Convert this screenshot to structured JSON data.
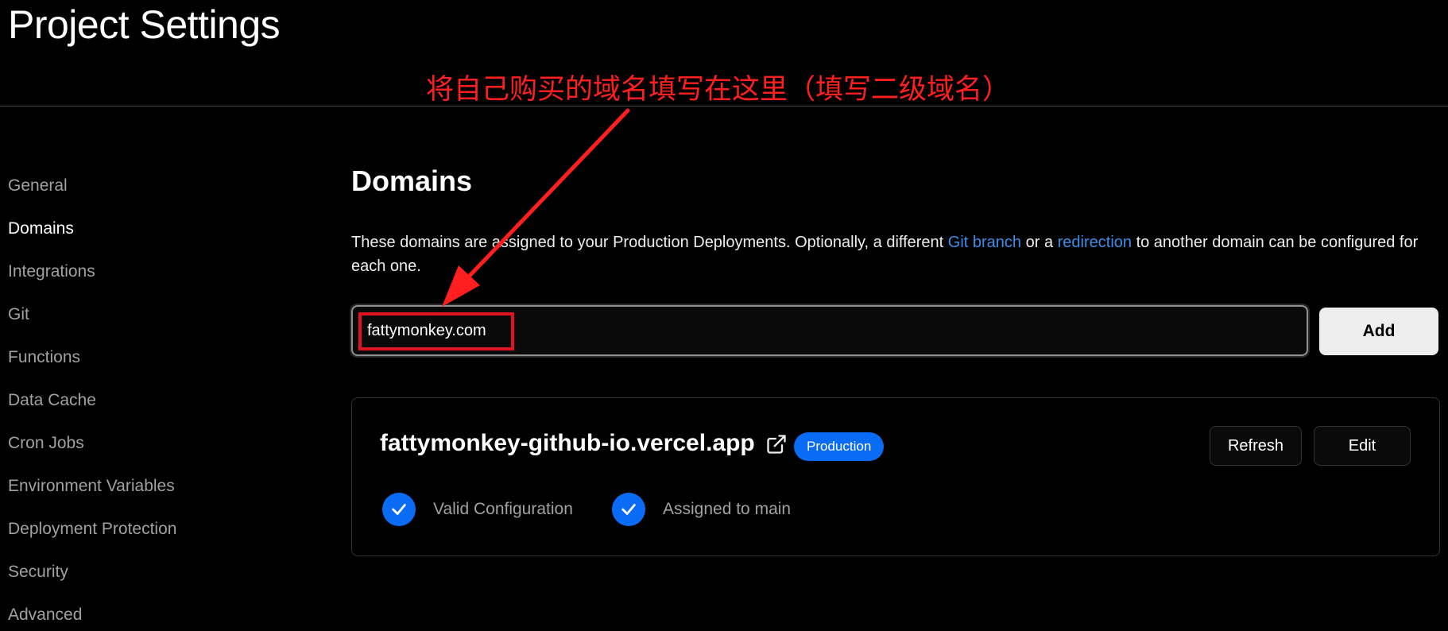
{
  "header": {
    "title": "Project Settings"
  },
  "annotation": {
    "text": "将自己购买的域名填写在这里（填写二级域名）",
    "color": "#ff1f1f"
  },
  "sidebar": {
    "items": [
      {
        "label": "General",
        "active": false
      },
      {
        "label": "Domains",
        "active": true
      },
      {
        "label": "Integrations",
        "active": false
      },
      {
        "label": "Git",
        "active": false
      },
      {
        "label": "Functions",
        "active": false
      },
      {
        "label": "Data Cache",
        "active": false
      },
      {
        "label": "Cron Jobs",
        "active": false
      },
      {
        "label": "Environment Variables",
        "active": false
      },
      {
        "label": "Deployment Protection",
        "active": false
      },
      {
        "label": "Security",
        "active": false
      },
      {
        "label": "Advanced",
        "active": false
      }
    ]
  },
  "domains": {
    "title": "Domains",
    "description": {
      "part1": "These domains are assigned to your Production Deployments. Optionally, a different ",
      "link1": "Git branch",
      "part2": " or a ",
      "link2": "redirection",
      "part3": " to another domain can be configured for each one."
    },
    "input": {
      "value": "fattymonkey.com",
      "placeholder": ""
    },
    "add_label": "Add",
    "card": {
      "domain": "fattymonkey-github-io.vercel.app",
      "badge": "Production",
      "refresh_label": "Refresh",
      "edit_label": "Edit",
      "status_valid": "Valid Configuration",
      "status_assigned": "Assigned to main"
    }
  },
  "colors": {
    "accent_blue": "#0a6cf5",
    "link_blue": "#3b8eea",
    "highlight_red": "#e0141e",
    "background": "#000000"
  },
  "icons": [
    "external-link-icon",
    "check-icon",
    "arrow-annotation"
  ]
}
